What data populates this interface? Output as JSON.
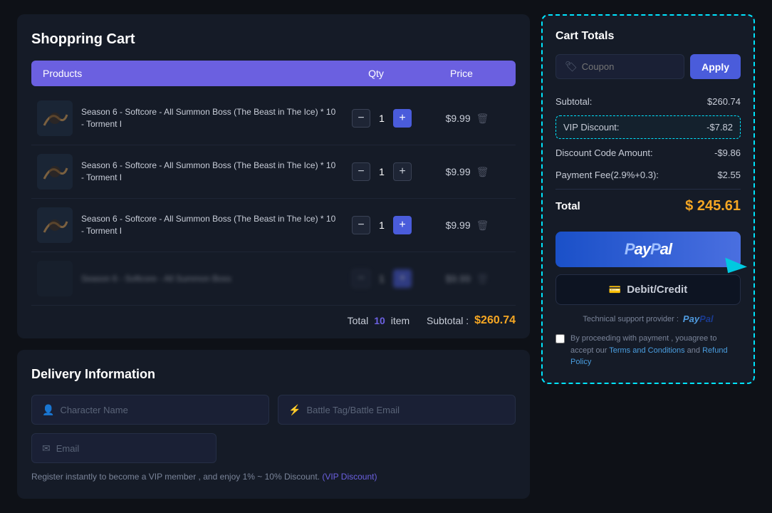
{
  "cart": {
    "title": "Shoppring Cart",
    "header": {
      "products": "Products",
      "qty": "Qty",
      "price": "Price"
    },
    "items": [
      {
        "name": "Season 6 - Softcore - All Summon Boss (The Beast in The Ice) * 10 - Torment I",
        "qty": 1,
        "price": "$9.99"
      },
      {
        "name": "Season 6 - Softcore - All Summon Boss (The Beast in The Ice) * 10 - Torment I",
        "qty": 1,
        "price": "$9.99"
      },
      {
        "name": "Season 6 - Softcore - All Summon Boss (The Beast in The Ice) * 10 - Torment I",
        "qty": 1,
        "price": "$9.99"
      },
      {
        "name": "Season 6 - Softcore - All Summon Boss",
        "qty": 1,
        "price": "$9.99",
        "blurred": true
      }
    ],
    "footer": {
      "label": "Total",
      "count": "10",
      "item_label": "item",
      "subtotal_label": "Subtotal :",
      "subtotal_value": "$260.74"
    }
  },
  "delivery": {
    "title": "Delivery Information",
    "fields": {
      "character_name": "Character Name",
      "battle_tag": "Battle Tag/Battle Email",
      "email": "Email"
    },
    "vip_notice": "Register instantly to become a VIP member , and enjoy 1% ~ 10% Discount.",
    "vip_link": "(VIP Discount)"
  },
  "cart_totals": {
    "title": "Cart Totals",
    "coupon": {
      "placeholder": "Coupon",
      "apply_label": "Apply"
    },
    "rows": [
      {
        "label": "Subtotal:",
        "value": "$260.74"
      },
      {
        "label": "VIP Discount:",
        "value": "-$7.82",
        "highlight": true
      },
      {
        "label": "Discount Code Amount:",
        "value": "-$9.86"
      },
      {
        "label": "Payment Fee(2.9%+0.3):",
        "value": "$2.55"
      },
      {
        "label": "Total",
        "value": "$ 245.61",
        "final": true
      }
    ],
    "paypal_label": "Pay",
    "debit_label": "Debit/Credit",
    "tech_support": "Technical support provider :",
    "terms_text": "By proceeding with payment , youagree to accept our Terms and Conditions and Refund Policy",
    "terms_link1": "Terms and Conditions",
    "terms_link2": "Refund Policy"
  }
}
